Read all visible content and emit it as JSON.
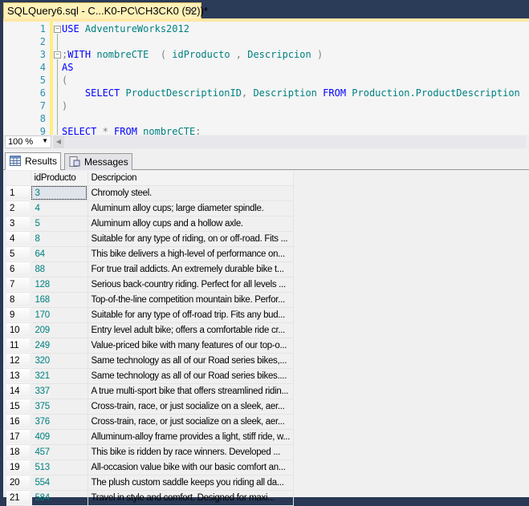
{
  "tab": {
    "title": "SQLQuery6.sql - C...K0-PC\\CH3CK0 (52))*",
    "close": "✕"
  },
  "editor": {
    "lines": [
      [
        {
          "t": "USE ",
          "c": "kw"
        },
        {
          "t": "AdventureWorks2012",
          "c": "id"
        }
      ],
      [],
      [
        {
          "t": ";",
          "c": "gr"
        },
        {
          "t": "WITH ",
          "c": "kw"
        },
        {
          "t": "nombreCTE  ",
          "c": "id"
        },
        {
          "t": "( ",
          "c": "gr"
        },
        {
          "t": "idProducto ",
          "c": "id"
        },
        {
          "t": ", ",
          "c": "gr"
        },
        {
          "t": "Descripcion ",
          "c": "id"
        },
        {
          "t": ")",
          "c": "gr"
        }
      ],
      [
        {
          "t": "AS",
          "c": "kw"
        }
      ],
      [
        {
          "t": "(",
          "c": "gr"
        }
      ],
      [
        {
          "t": "    SELECT ",
          "c": "kw"
        },
        {
          "t": "ProductDescriptionID",
          "c": "id"
        },
        {
          "t": ", ",
          "c": "gr"
        },
        {
          "t": "Description ",
          "c": "id"
        },
        {
          "t": "FROM ",
          "c": "kw"
        },
        {
          "t": "Production.ProductDescription",
          "c": "id"
        }
      ],
      [
        {
          "t": ")",
          "c": "gr"
        }
      ],
      [],
      [
        {
          "t": "SELECT ",
          "c": "kw"
        },
        {
          "t": "* ",
          "c": "gr"
        },
        {
          "t": "FROM ",
          "c": "kw"
        },
        {
          "t": "nombreCTE",
          "c": "id"
        },
        {
          "t": ";",
          "c": "gr"
        }
      ]
    ]
  },
  "zoom": {
    "value": "100 %"
  },
  "results_tabs": {
    "results": "Results",
    "messages": "Messages"
  },
  "grid": {
    "columns": [
      "idProducto",
      "Descripcion"
    ],
    "rows": [
      [
        "1",
        "3",
        "Chromoly steel."
      ],
      [
        "2",
        "4",
        "Aluminum alloy cups; large diameter spindle."
      ],
      [
        "3",
        "5",
        "Aluminum alloy cups and a hollow axle."
      ],
      [
        "4",
        "8",
        "Suitable for any type of riding, on or off-road. Fits ..."
      ],
      [
        "5",
        "64",
        "This bike delivers a high-level of performance on..."
      ],
      [
        "6",
        "88",
        "For true trail addicts.  An extremely durable bike t..."
      ],
      [
        "7",
        "128",
        "Serious back-country riding. Perfect for all levels ..."
      ],
      [
        "8",
        "168",
        "Top-of-the-line competition mountain bike. Perfor..."
      ],
      [
        "9",
        "170",
        "Suitable for any type of off-road trip. Fits any bud..."
      ],
      [
        "10",
        "209",
        "Entry level adult bike; offers a comfortable ride cr..."
      ],
      [
        "11",
        "249",
        "Value-priced bike with many features of our top-o..."
      ],
      [
        "12",
        "320",
        "Same technology as all of our Road series bikes,..."
      ],
      [
        "13",
        "321",
        "Same technology as all of our Road series bikes...."
      ],
      [
        "14",
        "337",
        "A true multi-sport bike that offers streamlined ridin..."
      ],
      [
        "15",
        "375",
        "Cross-train, race, or just socialize on a sleek, aer..."
      ],
      [
        "16",
        "376",
        "Cross-train, race, or just socialize on a sleek, aer..."
      ],
      [
        "17",
        "409",
        "Alluminum-alloy frame provides a light, stiff ride, w..."
      ],
      [
        "18",
        "457",
        "This bike is ridden by race winners. Developed ..."
      ],
      [
        "19",
        "513",
        "All-occasion value bike with our basic comfort an..."
      ],
      [
        "20",
        "554",
        "The plush custom saddle keeps you riding all da..."
      ],
      [
        "21",
        "584",
        "Travel in style and comfort. Designed for maxi..."
      ]
    ]
  }
}
